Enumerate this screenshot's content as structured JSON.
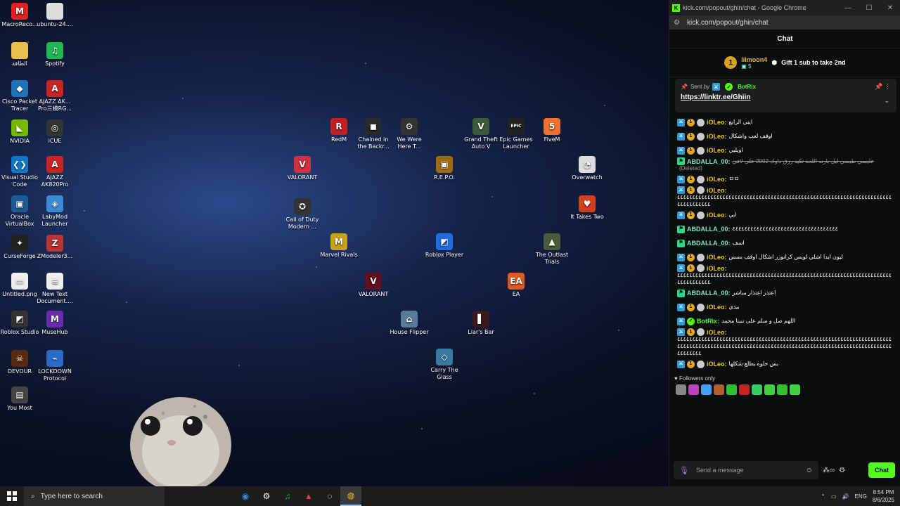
{
  "desktop": {
    "icons": [
      {
        "label": "MacroReco...",
        "glyph": "M",
        "color": "#d22"
      },
      {
        "label": "ubuntu-24....",
        "glyph": "",
        "color": "#ddd"
      },
      {
        "label": "الطاقة",
        "glyph": "",
        "color": "#e8c04a"
      },
      {
        "label": "Spotify",
        "glyph": "♫",
        "color": "#1db954"
      },
      {
        "label": "Cisco Packet Tracer",
        "glyph": "◆",
        "color": "#1f74b8"
      },
      {
        "label": "AJAZZ AK... Pro三模RG...",
        "glyph": "A",
        "color": "#c22"
      },
      {
        "label": "NVIDIA",
        "glyph": "◣",
        "color": "#76b900"
      },
      {
        "label": "iCUE",
        "glyph": "◎",
        "color": "#333"
      },
      {
        "label": "Visual Studio Code",
        "glyph": "❮❯",
        "color": "#0a7acc"
      },
      {
        "label": "AJAZZ AK820Pro",
        "glyph": "A",
        "color": "#c22"
      },
      {
        "label": "Oracle VirtualBox",
        "glyph": "▣",
        "color": "#1c5a9a"
      },
      {
        "label": "LabyMod Launcher",
        "glyph": "◈",
        "color": "#3a8ad6"
      },
      {
        "label": "CurseForge",
        "glyph": "✦",
        "color": "#222"
      },
      {
        "label": "ZModeler3...",
        "glyph": "Z",
        "color": "#b33"
      },
      {
        "label": "Untitled.png",
        "glyph": "▭",
        "color": "#eee"
      },
      {
        "label": "New Text Document....",
        "glyph": "≡",
        "color": "#eee"
      },
      {
        "label": "Roblox Studio",
        "glyph": "◩",
        "color": "#333"
      },
      {
        "label": "MuseHub",
        "glyph": "M",
        "color": "#6a2bb0"
      },
      {
        "label": "DEVOUR",
        "glyph": "☠",
        "color": "#5a2a10"
      },
      {
        "label": "LOCKDOWN Protocol",
        "glyph": "⌁",
        "color": "#2a6ac9"
      },
      {
        "label": "You Most",
        "glyph": "▤",
        "color": "#444"
      },
      {
        "label": "RedM",
        "glyph": "R",
        "color": "#c02020"
      },
      {
        "label": "Chained in the Backr...",
        "glyph": "◼",
        "color": "#2a2a2a"
      },
      {
        "label": "We Were Here T...",
        "glyph": "⚙",
        "color": "#333"
      },
      {
        "label": "Grand Theft Auto V",
        "glyph": "V",
        "color": "#3a5a3a"
      },
      {
        "label": "Epic Games Launcher",
        "glyph": "EPIC",
        "color": "#222"
      },
      {
        "label": "FiveM",
        "glyph": "5",
        "color": "#f07030"
      },
      {
        "label": "VALORANT",
        "glyph": "V",
        "color": "#d03040"
      },
      {
        "label": "R.E.P.O.",
        "glyph": "▣",
        "color": "#a06a10"
      },
      {
        "label": "Overwatch",
        "glyph": "◔",
        "color": "#ddd"
      },
      {
        "label": "Call of Duty Modern ...",
        "glyph": "✪",
        "color": "#333"
      },
      {
        "label": "It Takes Two",
        "glyph": "♥",
        "color": "#d04020"
      },
      {
        "label": "Marvel Rivals",
        "glyph": "M",
        "color": "#c8a020"
      },
      {
        "label": "Roblox Player",
        "glyph": "◩",
        "color": "#1f6de0"
      },
      {
        "label": "The Outlast Trials",
        "glyph": "▲",
        "color": "#4a5a3a"
      },
      {
        "label": "VALORANT",
        "glyph": "V",
        "color": "#601020"
      },
      {
        "label": "EA",
        "glyph": "EA",
        "color": "#e05a20"
      },
      {
        "label": "House Flipper",
        "glyph": "⌂",
        "color": "#5a7a9a"
      },
      {
        "label": "Liar's Bar",
        "glyph": "▌",
        "color": "#3a1a1a"
      },
      {
        "label": "Carry The Glass",
        "glyph": "◇",
        "color": "#3a7aa0"
      }
    ]
  },
  "chat_window": {
    "title": "kick.com/popout/ghin/chat - Google Chrome",
    "url": "kick.com/popout/ghin/chat",
    "header": "Chat",
    "sub_banner": {
      "user": "lilmoon4",
      "count": "5",
      "text": "Gift 1 sub to take 2nd",
      "avatar": "1"
    },
    "pinned": {
      "sent_by_label": "Sent by",
      "user": "BotRix",
      "link": "https://linktr.ee/Ghiin"
    },
    "messages": [
      {
        "user": "iOLeo:",
        "cls": "leo",
        "text": "ايبي الرابع",
        "badges": [
          "mod",
          "sub",
          "grey"
        ]
      },
      {
        "user": "iOLeo:",
        "cls": "leo",
        "text": "اوقف لعب واشكال",
        "badges": [
          "mod",
          "sub",
          "grey"
        ]
      },
      {
        "user": "iOLeo:",
        "cls": "leo",
        "text": "اويليي",
        "badges": [
          "mod",
          "sub",
          "grey"
        ]
      },
      {
        "user": "ABDALLA_00:",
        "cls": "abd",
        "text": "عليسي طيسي ليل بارنه اللحة تكيد رزق داوك 2002 على لافي",
        "deleted": "(Deleted)",
        "badges": [
          "green"
        ]
      },
      {
        "user": "iOLeo:",
        "cls": "leo",
        "text": "ㅁㅁ",
        "badges": [
          "mod",
          "sub",
          "grey"
        ]
      },
      {
        "user": "iOLeo:",
        "cls": "leo",
        "text": "",
        "long": "٤٤٤٤٤٤٤٤٤٤٤٤٤٤٤٤٤٤٤٤٤٤٤٤٤٤٤٤٤٤٤٤٤٤٤٤٤٤٤٤٤٤٤٤٤٤٤٤٤٤٤٤٤٤٤٤٤٤٤٤٤٤٤٤٤٤٤٤٤٤٤٤٤٤٤٤٤٤٤٤٤٤",
        "badges": [
          "mod",
          "sub",
          "grey"
        ]
      },
      {
        "user": "iOLeo:",
        "cls": "leo",
        "text": "ابي",
        "badges": [
          "mod",
          "sub",
          "grey"
        ]
      },
      {
        "user": "ABDALLA_00:",
        "cls": "abd",
        "text": "٤٤٤٤٤٤٤٤٤٤٤٤٤٤٤٤٤٤٤٤٤٤٤٤٤٤٤٤٤٤٤٤٤٤٤",
        "badges": [
          "green"
        ]
      },
      {
        "user": "ABDALLA_00:",
        "cls": "abd",
        "text": "اسف",
        "badges": [
          "green"
        ]
      },
      {
        "user": "iOLeo:",
        "cls": "leo",
        "text": "ليون ايدا اشلي لويس كرانوزر اشكال اوقف بسس",
        "badges": [
          "mod",
          "sub",
          "grey"
        ]
      },
      {
        "user": "iOLeo:",
        "cls": "leo",
        "text": "",
        "long": "٤٤٤٤٤٤٤٤٤٤٤٤٤٤٤٤٤٤٤٤٤٤٤٤٤٤٤٤٤٤٤٤٤٤٤٤٤٤٤٤٤٤٤٤٤٤٤٤٤٤٤٤٤٤٤٤٤٤٤٤٤٤٤٤٤٤٤٤٤٤٤٤٤٤٤٤٤٤٤٤٤٤",
        "badges": [
          "mod",
          "sub",
          "grey"
        ]
      },
      {
        "user": "ABDALLA_00:",
        "cls": "abd",
        "text": "اعتذر اعتذار مباشر",
        "badges": [
          "green"
        ]
      },
      {
        "user": "iOLeo:",
        "cls": "leo",
        "text": "بيدي",
        "badges": [
          "mod",
          "sub",
          "grey"
        ]
      },
      {
        "user": "BotRix:",
        "cls": "bot",
        "text": "اللهم صل و سلم على نبينا محمد",
        "badges": [
          "mod",
          "verify"
        ]
      },
      {
        "user": "iOLeo:",
        "cls": "leo",
        "text": "",
        "long": "٤٤٤٤٤٤٤٤٤٤٤٤٤٤٤٤٤٤٤٤٤٤٤٤٤٤٤٤٤٤٤٤٤٤٤٤٤٤٤٤٤٤٤٤٤٤٤٤٤٤٤٤٤٤٤٤٤٤٤٤٤٤٤٤٤٤٤٤٤٤٤٤٤٤٤٤٤٤٤٤٤٤٤٤٤٤٤٤٤٤٤٤٤٤٤٤٤٤٤٤٤٤٤٤٤٤٤٤٤٤٤٤٤٤٤٤٤٤٤٤٤٤٤٤٤٤٤٤٤٤٤٤٤٤٤٤٤٤٤٤٤٤٤٤٤٤٤٤٤٤",
        "badges": [
          "mod",
          "sub",
          "grey"
        ]
      },
      {
        "user": "iOLeo:",
        "cls": "leo",
        "text": "بس حلوه يطلع شكلها",
        "badges": [
          "mod",
          "sub",
          "grey"
        ]
      }
    ],
    "followers_only": "Followers only",
    "input_placeholder": "Send a message",
    "chat_button": "Chat",
    "emote_colors": [
      "#888",
      "#c040c0",
      "#40a0ff",
      "#b06030",
      "#30c030",
      "#d02020",
      "#30d060",
      "#40d040",
      "#30c030",
      "#40d040"
    ]
  },
  "taskbar": {
    "search_placeholder": "Type here to search",
    "lang": "ENG",
    "time": "8:54 PM",
    "date": "8/6/2025"
  }
}
